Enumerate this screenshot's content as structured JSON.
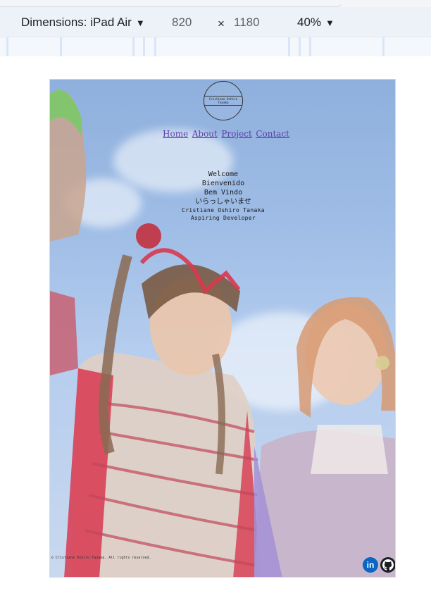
{
  "devtools": {
    "dimensions_label": "Dimensions: iPad Air",
    "width_value": "820",
    "times_symbol": "×",
    "height_value": "1180",
    "zoom_value": "40%"
  },
  "page": {
    "nav": [
      {
        "label": "Home"
      },
      {
        "label": "About"
      },
      {
        "label": "Project"
      },
      {
        "label": "Contact"
      }
    ],
    "welcome_lines": [
      "Welcome",
      "Bienvenido",
      "Bem Vindo",
      "いらっしゃいませ"
    ],
    "owner_name": "Cristiane Oshiro Tanaka",
    "owner_title": "Aspiring Developer",
    "footer": "© Cristiane Oshiro Tanaka. All rights reserved.",
    "social": {
      "linkedin_glyph": "in"
    }
  },
  "colors": {
    "nav_link": "#5b3ea8",
    "linkedin": "#0a66c2",
    "github": "#1b1f23",
    "toolbar_bg": "#edf1f8"
  }
}
